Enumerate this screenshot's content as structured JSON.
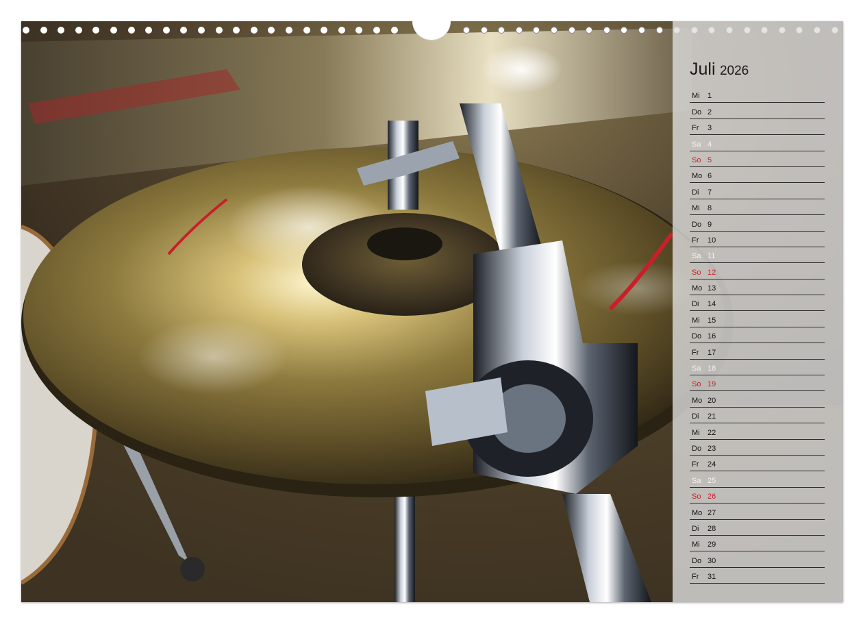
{
  "calendar": {
    "month": "Juli",
    "year": "2026",
    "days": [
      {
        "weekday": "Mi",
        "day": "1",
        "type": "weekday"
      },
      {
        "weekday": "Do",
        "day": "2",
        "type": "weekday"
      },
      {
        "weekday": "Fr",
        "day": "3",
        "type": "weekday"
      },
      {
        "weekday": "Sa",
        "day": "4",
        "type": "saturday"
      },
      {
        "weekday": "So",
        "day": "5",
        "type": "sunday"
      },
      {
        "weekday": "Mo",
        "day": "6",
        "type": "weekday"
      },
      {
        "weekday": "Di",
        "day": "7",
        "type": "weekday"
      },
      {
        "weekday": "Mi",
        "day": "8",
        "type": "weekday"
      },
      {
        "weekday": "Do",
        "day": "9",
        "type": "weekday"
      },
      {
        "weekday": "Fr",
        "day": "10",
        "type": "weekday"
      },
      {
        "weekday": "Sa",
        "day": "11",
        "type": "saturday"
      },
      {
        "weekday": "So",
        "day": "12",
        "type": "sunday"
      },
      {
        "weekday": "Mo",
        "day": "13",
        "type": "weekday"
      },
      {
        "weekday": "Di",
        "day": "14",
        "type": "weekday"
      },
      {
        "weekday": "Mi",
        "day": "15",
        "type": "weekday"
      },
      {
        "weekday": "Do",
        "day": "16",
        "type": "weekday"
      },
      {
        "weekday": "Fr",
        "day": "17",
        "type": "weekday"
      },
      {
        "weekday": "Sa",
        "day": "18",
        "type": "saturday"
      },
      {
        "weekday": "So",
        "day": "19",
        "type": "sunday"
      },
      {
        "weekday": "Mo",
        "day": "20",
        "type": "weekday"
      },
      {
        "weekday": "Di",
        "day": "21",
        "type": "weekday"
      },
      {
        "weekday": "Mi",
        "day": "22",
        "type": "weekday"
      },
      {
        "weekday": "Do",
        "day": "23",
        "type": "weekday"
      },
      {
        "weekday": "Fr",
        "day": "24",
        "type": "weekday"
      },
      {
        "weekday": "Sa",
        "day": "25",
        "type": "saturday"
      },
      {
        "weekday": "So",
        "day": "26",
        "type": "sunday"
      },
      {
        "weekday": "Mo",
        "day": "27",
        "type": "weekday"
      },
      {
        "weekday": "Di",
        "day": "28",
        "type": "weekday"
      },
      {
        "weekday": "Mi",
        "day": "29",
        "type": "weekday"
      },
      {
        "weekday": "Do",
        "day": "30",
        "type": "weekday"
      },
      {
        "weekday": "Fr",
        "day": "31",
        "type": "weekday"
      }
    ]
  },
  "colors": {
    "sunday": "#c8202a",
    "saturday": "#f2f2f2",
    "weekday": "#111111",
    "panel": "#dedede"
  },
  "photo": {
    "subject": "cymbal-on-drum-stand"
  },
  "binding": {
    "hole_count_left": 22,
    "hole_count_right": 22
  }
}
